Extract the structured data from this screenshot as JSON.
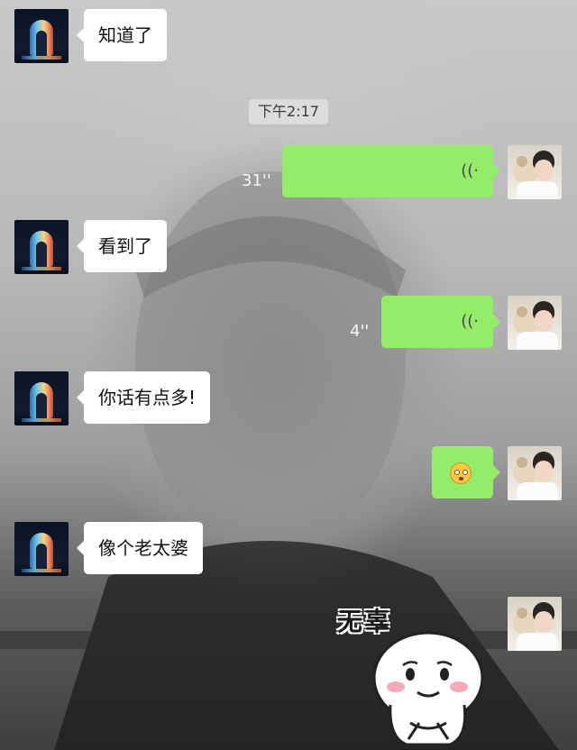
{
  "timestamp": "下午2:17",
  "messages": [
    {
      "side": "received",
      "type": "text",
      "text": "知道了"
    },
    {
      "side": "sent",
      "type": "voice",
      "duration": "31''",
      "icon": "voice-wave-icon"
    },
    {
      "side": "received",
      "type": "text",
      "text": "看到了"
    },
    {
      "side": "sent",
      "type": "voice",
      "duration": "4''",
      "icon": "voice-wave-icon"
    },
    {
      "side": "received",
      "type": "text",
      "text": "你话有点多!"
    },
    {
      "side": "sent",
      "type": "emoji",
      "icon": "wide-eyed-face-emoji"
    },
    {
      "side": "received",
      "type": "text",
      "text": "像个老太婆"
    },
    {
      "side": "sent",
      "type": "sticker",
      "caption": "无辜",
      "icon": "innocent-dumpling-sticker"
    }
  ],
  "colors": {
    "sent_bubble": "#95ec69",
    "received_bubble": "#ffffff",
    "timestamp_bg": "#dcdcdc"
  }
}
